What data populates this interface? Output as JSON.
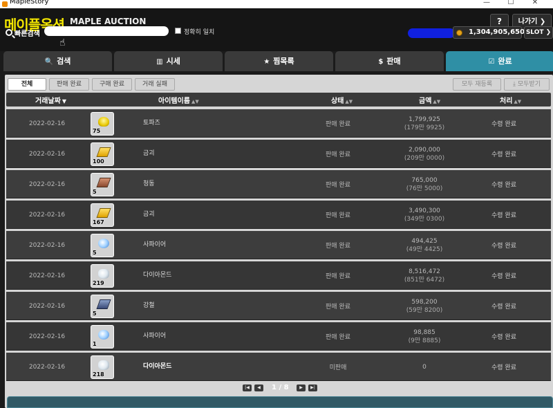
{
  "window": {
    "title": "MapleStory",
    "controls": [
      "—",
      "☐",
      "✕"
    ]
  },
  "header": {
    "logo_ko": "메이플옥션",
    "logo_en": "MAPLE AUCTION",
    "help_label": "?",
    "exit_label": "나가기 ❯",
    "search_label": "빠른검색",
    "search_value": "",
    "exact_match_label": "정확히 일치",
    "meso": "1,304,905,650",
    "slot_label": "SLOT ❯"
  },
  "tabs": [
    {
      "label": "검색",
      "icon": "🔍"
    },
    {
      "label": "시세",
      "icon": "▥"
    },
    {
      "label": "찜목록",
      "icon": "★"
    },
    {
      "label": "판매",
      "icon": "$"
    },
    {
      "label": "완료",
      "icon": "☑"
    }
  ],
  "filters": {
    "all": "전체",
    "sold": "판매 완료",
    "bought": "구매 완료",
    "failed": "거래 실패",
    "relist_all": "모두 재등록",
    "receive_all": "⤓ 모두받기"
  },
  "columns": {
    "date": "거래날짜",
    "item_name": "아이템이름",
    "state": "상태",
    "amount": "금액",
    "process": "처리"
  },
  "rows": [
    {
      "date": "2022-02-16",
      "qty": "75",
      "name": "토파즈",
      "state": "판매 완료",
      "price": "1,799,925",
      "price_sub": "(179만 9925)",
      "process": "수령 완료",
      "icon": "topaz-icon"
    },
    {
      "date": "2022-02-16",
      "qty": "100",
      "name": "금괴",
      "state": "판매 완료",
      "price": "2,090,000",
      "price_sub": "(209만 0000)",
      "process": "수령 완료",
      "icon": "gold-bar-icon"
    },
    {
      "date": "2022-02-16",
      "qty": "5",
      "name": "청동",
      "state": "판매 완료",
      "price": "765,000",
      "price_sub": "(76만 5000)",
      "process": "수령 완료",
      "icon": "bronze-bar-icon"
    },
    {
      "date": "2022-02-16",
      "qty": "167",
      "name": "금괴",
      "state": "판매 완료",
      "price": "3,490,300",
      "price_sub": "(349만 0300)",
      "process": "수령 완료",
      "icon": "gold-bar-icon"
    },
    {
      "date": "2022-02-16",
      "qty": "5",
      "name": "사파이어",
      "state": "판매 완료",
      "price": "494,425",
      "price_sub": "(49만 4425)",
      "process": "수령 완료",
      "icon": "sapphire-icon"
    },
    {
      "date": "2022-02-16",
      "qty": "219",
      "name": "다이아몬드",
      "state": "판매 완료",
      "price": "8,516,472",
      "price_sub": "(851만 6472)",
      "process": "수령 완료",
      "icon": "diamond-icon"
    },
    {
      "date": "2022-02-16",
      "qty": "5",
      "name": "강철",
      "state": "판매 완료",
      "price": "598,200",
      "price_sub": "(59만 8200)",
      "process": "수령 완료",
      "icon": "steel-bar-icon"
    },
    {
      "date": "2022-02-16",
      "qty": "1",
      "name": "사파이어",
      "state": "판매 완료",
      "price": "98,885",
      "price_sub": "(9만 8885)",
      "process": "수령 완료",
      "icon": "sapphire-icon"
    },
    {
      "date": "2022-02-16",
      "qty": "218",
      "name": "다이아몬드",
      "state": "미판매",
      "price": "0",
      "price_sub": "",
      "process": "수령 완료",
      "icon": "diamond-icon"
    }
  ],
  "pager": {
    "text": "1 / 8",
    "first": "|◀",
    "prev": "◀",
    "next": "▶",
    "last": "▶|"
  },
  "colors": {
    "accent": "#2f8fa5",
    "logo": "#f3e600"
  }
}
